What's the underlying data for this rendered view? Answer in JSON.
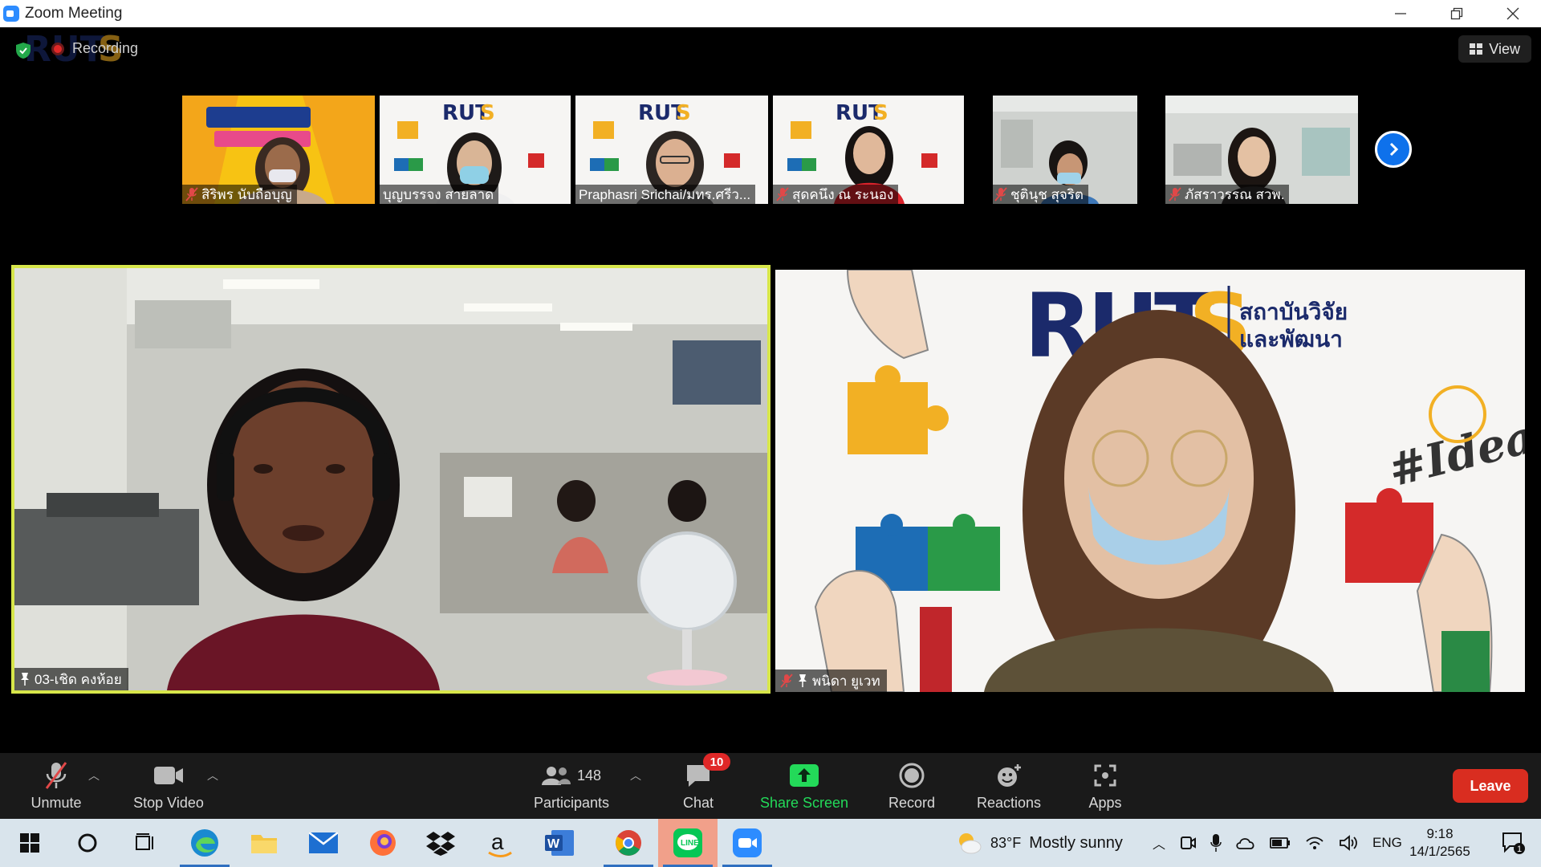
{
  "window": {
    "title": "Zoom Meeting",
    "controls": [
      "minimize",
      "restore",
      "close"
    ]
  },
  "meeting": {
    "recording_label": "Recording",
    "view_label": "View"
  },
  "thumbnails": [
    {
      "name": "สิริพร นับถือบุญ",
      "muted": true,
      "background": "yellow-banner"
    },
    {
      "name": "บุญบรรจง  สายลาด",
      "muted": false,
      "background": "ruts"
    },
    {
      "name": "Praphasri  Srichai/มทร.ศรีว...",
      "muted": false,
      "background": "ruts"
    },
    {
      "name": "สุดคนึง ณ ระนอง",
      "muted": true,
      "background": "ruts"
    },
    {
      "name": "ชุตินุช สุจริต",
      "muted": true,
      "background": "office"
    },
    {
      "name": "ภัสราวรรณ สวพ.",
      "muted": true,
      "background": "office"
    }
  ],
  "main_videos": {
    "left_name": "03-เชิด คงห้อย",
    "right_name": "พนิดา ยูเวท",
    "ruts_logo_text": "RUTS",
    "ruts_thai_line1": "สถาบันวิจัย",
    "ruts_thai_line2": "และพัฒนา",
    "ideas_text": "#Ideas"
  },
  "toolbar": {
    "unmute": "Unmute",
    "stop_video": "Stop Video",
    "participants": "Participants",
    "participants_count": "148",
    "chat": "Chat",
    "chat_badge": "10",
    "share_screen": "Share Screen",
    "record": "Record",
    "reactions": "Reactions",
    "apps": "Apps",
    "leave": "Leave"
  },
  "taskbar": {
    "apps": [
      "windows-start",
      "cortana",
      "task-view",
      "edge",
      "file-explorer",
      "mail",
      "firefox",
      "dropbox",
      "amazon",
      "word",
      "chrome",
      "line",
      "zoom"
    ],
    "weather_temp": "83°F",
    "weather_text": "Mostly sunny",
    "language": "ENG",
    "time": "9:18",
    "date": "14/1/2565",
    "notification_count": "1"
  },
  "colors": {
    "accent": "#0e71eb",
    "share_green": "#23d959",
    "leave_red": "#d92d20",
    "speaker_border": "#d7e64a",
    "ruts_navy": "#1b2a6b",
    "ruts_gold": "#f2b024"
  }
}
